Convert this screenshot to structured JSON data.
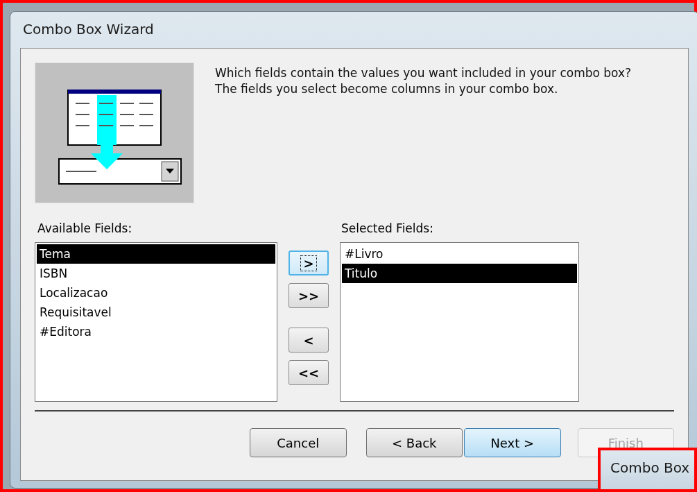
{
  "window": {
    "title": "Combo Box Wizard"
  },
  "instructions": "Which fields contain the values you want included in your combo box? The fields you select become columns in your combo box.",
  "available_fields": {
    "label": "Available Fields:",
    "items": [
      {
        "label": "Tema",
        "selected": true
      },
      {
        "label": "ISBN",
        "selected": false
      },
      {
        "label": "Localizacao",
        "selected": false
      },
      {
        "label": "Requisitavel",
        "selected": false
      },
      {
        "label": "#Editora",
        "selected": false
      }
    ]
  },
  "move_buttons": [
    {
      "label": ">",
      "focused": true
    },
    {
      "label": ">>",
      "focused": false
    },
    {
      "label": "<",
      "focused": false
    },
    {
      "label": "<<",
      "focused": false
    }
  ],
  "selected_fields": {
    "label": "Selected Fields:",
    "items": [
      {
        "label": "#Livro",
        "selected": false
      },
      {
        "label": "Titulo",
        "selected": true
      }
    ]
  },
  "buttons": [
    {
      "label": "Cancel",
      "default": false,
      "disabled": false
    },
    {
      "label": "< Back",
      "default": false,
      "disabled": false
    },
    {
      "label": "Next >",
      "default": true,
      "disabled": false
    },
    {
      "label": "Finish",
      "default": false,
      "disabled": true
    }
  ],
  "background_window": {
    "title": "Combo Box"
  }
}
